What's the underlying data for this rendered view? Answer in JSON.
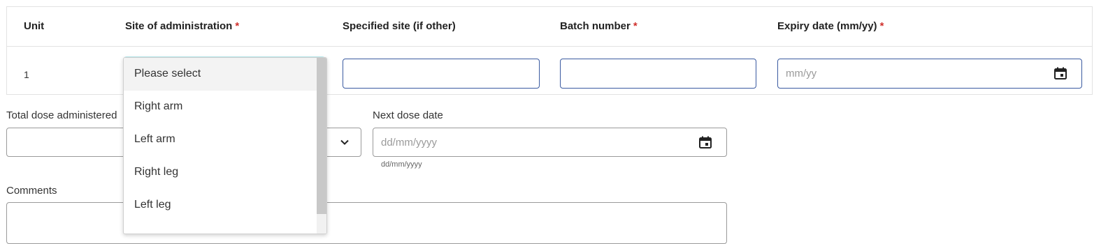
{
  "table": {
    "headers": {
      "unit": "Unit",
      "site": "Site of administration",
      "specified_site": "Specified site (if other)",
      "batch": "Batch number",
      "expiry": "Expiry date (mm/yy)"
    },
    "required_marker": "*",
    "row": {
      "unit": "1",
      "specified_site_value": "",
      "batch_value": "",
      "expiry_placeholder": "mm/yy"
    }
  },
  "site_dropdown": {
    "options": [
      "Please select",
      "Right arm",
      "Left arm",
      "Right leg",
      "Left leg"
    ],
    "selected": "Please select"
  },
  "total_dose": {
    "label": "Total dose administered",
    "value": ""
  },
  "next_dose": {
    "label": "Next dose date",
    "placeholder": "dd/mm/yyyy",
    "hint": "dd/mm/yyyy"
  },
  "comments": {
    "label": "Comments",
    "value": ""
  },
  "icons": {
    "calendar": "calendar-icon",
    "chevron": "chevron-down-icon"
  },
  "colors": {
    "input_border": "#3a5aa0",
    "required": "#d0312d",
    "focus_ring": "#b6ecf0"
  }
}
